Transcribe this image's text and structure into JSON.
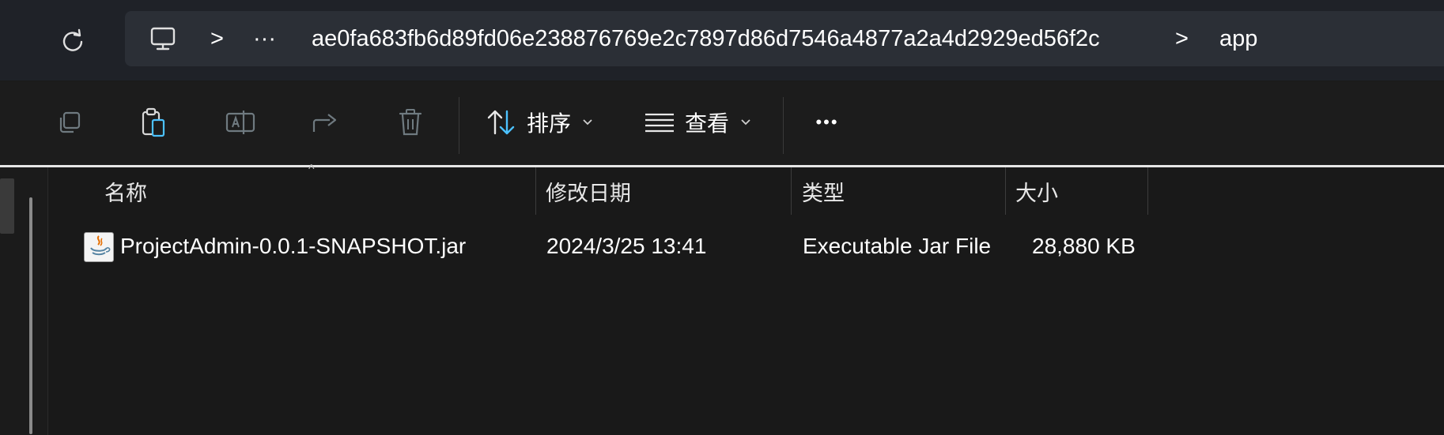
{
  "breadcrumb": {
    "path_id": "ae0fa683fb6d89fd06e238876769e2c7897d86d7546a4877a2a4d2929ed56f2c",
    "current": "app",
    "more": "···",
    "separator": ">"
  },
  "toolbar": {
    "sort_label": "排序",
    "view_label": "查看",
    "more_label": "•••"
  },
  "columns": [
    "名称",
    "修改日期",
    "类型",
    "大小"
  ],
  "files": [
    {
      "name": "ProjectAdmin-0.0.1-SNAPSHOT.jar",
      "modified": "2024/3/25 13:41",
      "type": "Executable Jar File",
      "size": "28,880 KB"
    }
  ],
  "colors": {
    "accent": "#4cc2ff",
    "background": "#191919",
    "addressbar": "#1f2228"
  },
  "icons": {
    "refresh": "refresh-icon",
    "computer": "computer-icon",
    "copy": "copy-icon",
    "paste": "paste-icon",
    "rename": "rename-icon",
    "share": "share-icon",
    "delete": "delete-icon",
    "sort": "sort-icon",
    "view": "view-icon",
    "file": "java-jar-icon"
  }
}
